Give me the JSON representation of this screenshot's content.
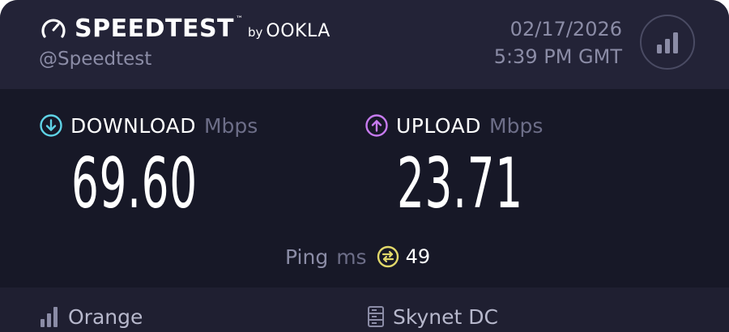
{
  "header": {
    "brand_name": "SPEEDTEST",
    "brand_by": "by",
    "brand_company": "OOKLA",
    "handle": "@Speedtest",
    "date": "02/17/2026",
    "time": "5:39 PM GMT"
  },
  "download": {
    "label": "DOWNLOAD",
    "unit": "Mbps",
    "value": "69.60",
    "accent_color": "#5fd3e6"
  },
  "upload": {
    "label": "UPLOAD",
    "unit": "Mbps",
    "value": "23.71",
    "accent_color": "#c77bf0"
  },
  "ping": {
    "label": "Ping",
    "unit": "ms",
    "value": "49",
    "accent_color": "#e2d86a"
  },
  "footer": {
    "isp": "Orange",
    "server": "Skynet DC"
  },
  "icons": {
    "brand": "gauge-icon",
    "share": "signal-bars-icon",
    "download": "arrow-down-circle-icon",
    "upload": "arrow-up-circle-icon",
    "ping": "ping-circle-icon",
    "isp": "signal-bars-icon",
    "server": "server-icon"
  }
}
